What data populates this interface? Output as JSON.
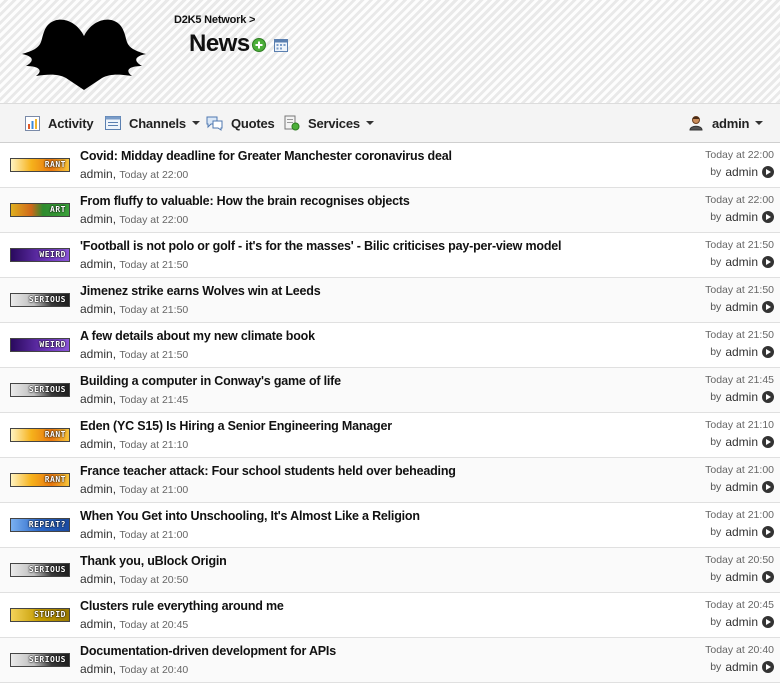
{
  "header": {
    "breadcrumb": "D2K5 Network >",
    "title": "News"
  },
  "nav": {
    "activity": "Activity",
    "channels": "Channels",
    "quotes": "Quotes",
    "services": "Services",
    "user": "admin"
  },
  "colors": {
    "rant": "#e8a300",
    "art": "#2e8b2e",
    "weird": "#5b2aa0",
    "serious": "#3a3a3a",
    "repeat": "#2a66c7",
    "stupid": "#c49b00"
  },
  "items": [
    {
      "badge": "RANT",
      "badge_type": "rant",
      "title": "Covid: Midday deadline for Greater Manchester coronavirus deal",
      "author": "admin",
      "time": "Today at 22:00",
      "right_time": "Today at 22:00",
      "by": "by",
      "right_author": "admin"
    },
    {
      "badge": "ART",
      "badge_type": "art",
      "title": "From fluffy to valuable: How the brain recognises objects",
      "author": "admin",
      "time": "Today at 22:00",
      "right_time": "Today at 22:00",
      "by": "by",
      "right_author": "admin"
    },
    {
      "badge": "WEIRD",
      "badge_type": "weird",
      "title": "'Football is not polo or golf - it's for the masses' - Bilic criticises pay-per-view model",
      "author": "admin",
      "time": "Today at 21:50",
      "right_time": "Today at 21:50",
      "by": "by",
      "right_author": "admin"
    },
    {
      "badge": "SERIOUS",
      "badge_type": "serious",
      "title": "Jimenez strike earns Wolves win at Leeds",
      "author": "admin",
      "time": "Today at 21:50",
      "right_time": "Today at 21:50",
      "by": "by",
      "right_author": "admin"
    },
    {
      "badge": "WEIRD",
      "badge_type": "weird",
      "title": "A few details about my new climate book",
      "author": "admin",
      "time": "Today at 21:50",
      "right_time": "Today at 21:50",
      "by": "by",
      "right_author": "admin"
    },
    {
      "badge": "SERIOUS",
      "badge_type": "serious",
      "title": "Building a computer in Conway's game of life",
      "author": "admin",
      "time": "Today at 21:45",
      "right_time": "Today at 21:45",
      "by": "by",
      "right_author": "admin"
    },
    {
      "badge": "RANT",
      "badge_type": "rant",
      "title": "Eden (YC S15) Is Hiring a Senior Engineering Manager",
      "author": "admin",
      "time": "Today at 21:10",
      "right_time": "Today at 21:10",
      "by": "by",
      "right_author": "admin"
    },
    {
      "badge": "RANT",
      "badge_type": "rant",
      "title": "France teacher attack: Four school students held over beheading",
      "author": "admin",
      "time": "Today at 21:00",
      "right_time": "Today at 21:00",
      "by": "by",
      "right_author": "admin"
    },
    {
      "badge": "REPEAT?",
      "badge_type": "repeat",
      "title": "When You Get into Unschooling, It's Almost Like a Religion",
      "author": "admin",
      "time": "Today at 21:00",
      "right_time": "Today at 21:00",
      "by": "by",
      "right_author": "admin"
    },
    {
      "badge": "SERIOUS",
      "badge_type": "serious",
      "title": "Thank you, uBlock Origin",
      "author": "admin",
      "time": "Today at 20:50",
      "right_time": "Today at 20:50",
      "by": "by",
      "right_author": "admin"
    },
    {
      "badge": "STUPID",
      "badge_type": "stupid",
      "title": "Clusters rule everything around me",
      "author": "admin",
      "time": "Today at 20:45",
      "right_time": "Today at 20:45",
      "by": "by",
      "right_author": "admin"
    },
    {
      "badge": "SERIOUS",
      "badge_type": "serious",
      "title": "Documentation-driven development for APIs",
      "author": "admin",
      "time": "Today at 20:40",
      "right_time": "Today at 20:40",
      "by": "by",
      "right_author": "admin"
    }
  ]
}
